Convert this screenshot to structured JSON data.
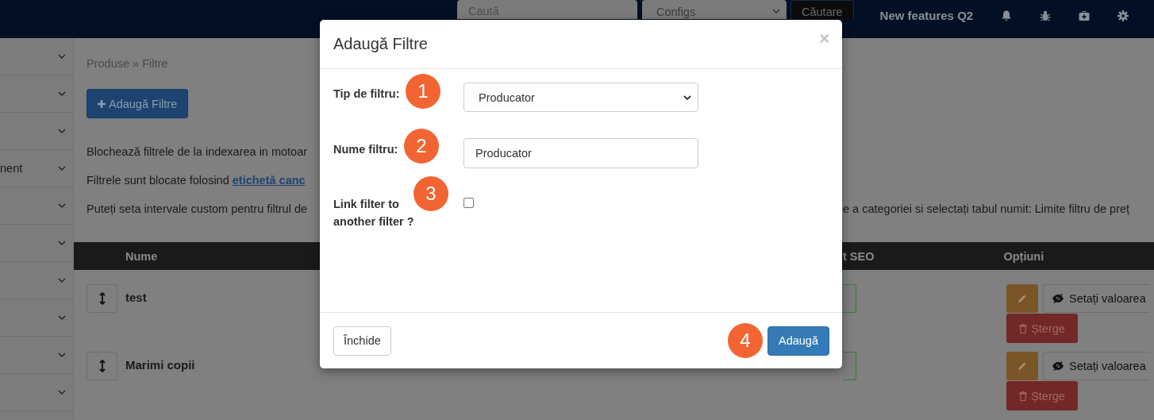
{
  "navbar": {
    "search": {
      "placeholder": "Caută"
    },
    "config_select": {
      "value": "Configs"
    },
    "search_button": "Căutare",
    "link": "New features Q2"
  },
  "sidebar": {
    "items": [
      {
        "expanded": false
      },
      {
        "expanded": false
      },
      {
        "expanded": false
      },
      {
        "label": "nent",
        "expanded": false
      },
      {
        "expanded": false
      },
      {
        "expanded": false
      },
      {
        "expanded": false
      },
      {
        "expanded": false
      },
      {
        "expanded": false
      },
      {
        "expanded": false
      }
    ]
  },
  "breadcrumb": "Produse » Filtre",
  "add_button": "Adaugă Filtre",
  "notes": [
    {
      "text": "Blochează filtrele de la indexarea in motoar"
    },
    {
      "text": "Filtrele sunt blocate folosind",
      "link": "etichetă canc"
    },
    {
      "text": "Puteți seta intervale custom pentru filtrul de",
      "text_right": "e a categoriei si selectați tabul numit: Limite filtru de preț"
    }
  ],
  "table": {
    "columns": [
      {
        "label": "Nume"
      },
      {
        "label": "t SEO"
      },
      {
        "label": "Opțiuni"
      }
    ],
    "rows": [
      {
        "name": "test",
        "seo_on": true,
        "set_value": "Setați valoarea",
        "delete": "Șterge"
      },
      {
        "name": "Marimi copii",
        "seo_on": true,
        "set_value": "Setați valoarea",
        "delete": "Șterge"
      }
    ]
  },
  "modal": {
    "title": "Adaugă Filtre",
    "close": "×",
    "fields": [
      {
        "kind": "select",
        "label": "Tip de filtru:",
        "value": "Producator",
        "step": "1"
      },
      {
        "kind": "text",
        "label": "Nume filtru:",
        "value": "Producator",
        "step": "2"
      },
      {
        "kind": "checkbox",
        "label": "Link filter to another filter ?",
        "checked": false,
        "step": "3"
      }
    ],
    "buttons": [
      {
        "kind": "default",
        "label": "Închide"
      },
      {
        "kind": "primary",
        "label": "Adaugă",
        "step": "4"
      }
    ]
  }
}
